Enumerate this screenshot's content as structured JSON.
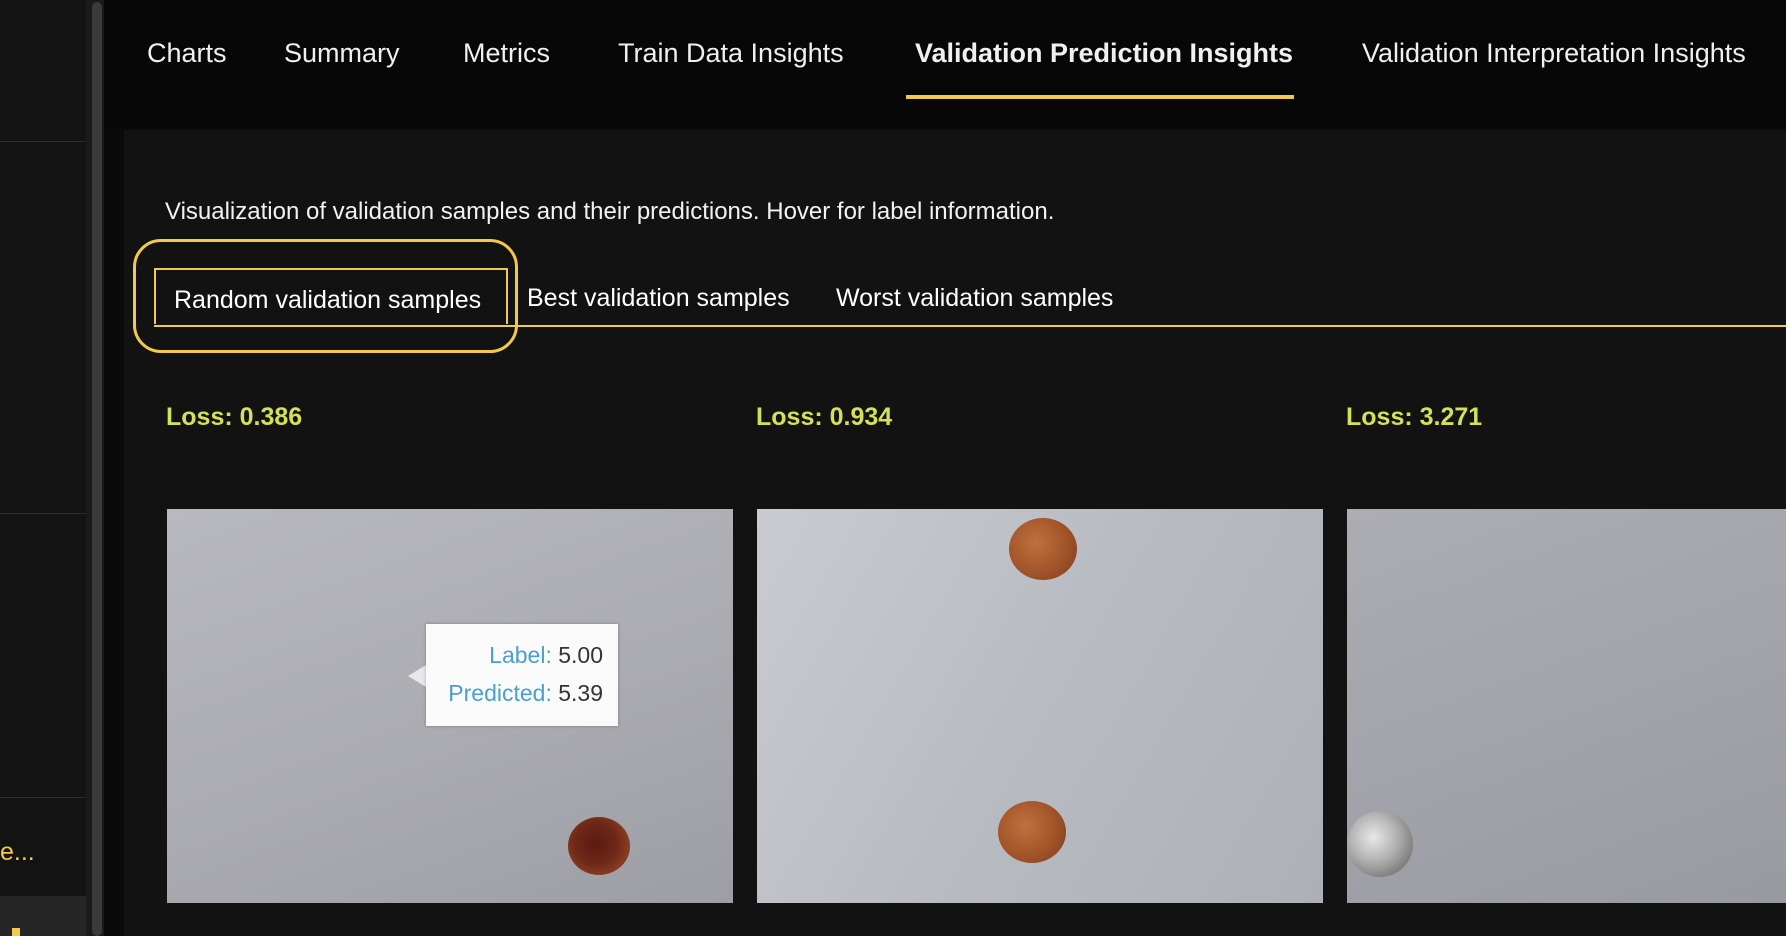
{
  "tabs": [
    {
      "label": "Charts"
    },
    {
      "label": "Summary"
    },
    {
      "label": "Metrics"
    },
    {
      "label": "Train Data Insights"
    },
    {
      "label": "Validation Prediction Insights",
      "active": true
    },
    {
      "label": "Validation Interpretation Insights"
    }
  ],
  "sidebar": {
    "truncated_item": "e..."
  },
  "content": {
    "description": "Visualization of validation samples and their predictions. Hover for label information.",
    "subtabs": [
      {
        "label": "Random validation samples",
        "active": true
      },
      {
        "label": "Best validation samples"
      },
      {
        "label": "Worst validation samples"
      }
    ],
    "samples": [
      {
        "loss": "Loss: 0.386"
      },
      {
        "loss": "Loss: 0.934"
      },
      {
        "loss": "Loss: 3.271"
      }
    ],
    "tooltip": {
      "label_key": "Label:",
      "label_value": "5.00",
      "predicted_key": "Predicted:",
      "predicted_value": "5.39"
    }
  },
  "colors": {
    "accent": "#f2c94c",
    "loss_text": "#d4e157",
    "tooltip_key": "#4a9fd0"
  }
}
